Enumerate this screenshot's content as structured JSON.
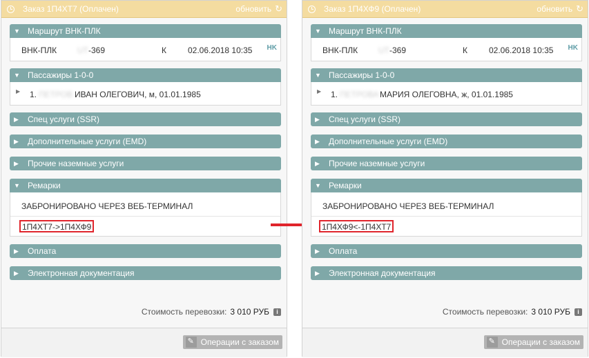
{
  "orders": [
    {
      "header": {
        "title": "Заказ 1П4ХТ7 (Оплачен)",
        "refresh_label": "обновить",
        "refresh_icon": "refresh-icon",
        "clock_icon": "clock-icon"
      },
      "route": {
        "title": "Маршрут ВНК-ПЛК",
        "segment": "ВНК-ПЛК",
        "flight_prefix": "UT",
        "flight_number": "-369",
        "class": "К",
        "datetime": "02.06.2018 10:35",
        "status": "HK"
      },
      "passengers": {
        "title": "Пассажиры 1-0-0",
        "index": "1.",
        "surname": "ПЕТРОВ",
        "name": "ИВАН ОЛЕГОВИЧ, м, 01.01.1985"
      },
      "sections": {
        "ssr": "Спец услуги (SSR)",
        "emd": "Дополнительные услуги (EMD)",
        "ground": "Прочие наземные услуги",
        "remarks": "Ремарки",
        "payment": "Оплата",
        "edocs": "Электронная документация"
      },
      "remarks": {
        "line1": "ЗАБРОНИРОВАНО ЧЕРЕЗ ВЕБ-ТЕРМИНАЛ",
        "line2": "1П4ХТ7->1П4ХФ9"
      },
      "cost": {
        "label": "Стоимость перевозки:",
        "value": "3 010 РУБ"
      },
      "footer": {
        "operations_label": "Операции с заказом"
      }
    },
    {
      "header": {
        "title": "Заказ 1П4ХФ9 (Оплачен)",
        "refresh_label": "обновить",
        "refresh_icon": "refresh-icon",
        "clock_icon": "clock-icon"
      },
      "route": {
        "title": "Маршрут ВНК-ПЛК",
        "segment": "ВНК-ПЛК",
        "flight_prefix": "UT",
        "flight_number": "-369",
        "class": "К",
        "datetime": "02.06.2018 10:35",
        "status": "HK"
      },
      "passengers": {
        "title": "Пассажиры 1-0-0",
        "index": "1.",
        "surname": "ПЕТРОВА",
        "name": "МАРИЯ ОЛЕГОВНА, ж, 01.01.1985"
      },
      "sections": {
        "ssr": "Спец услуги (SSR)",
        "emd": "Дополнительные услуги (EMD)",
        "ground": "Прочие наземные услуги",
        "remarks": "Ремарки",
        "payment": "Оплата",
        "edocs": "Электронная документация"
      },
      "remarks": {
        "line1": "ЗАБРОНИРОВАНО ЧЕРЕЗ ВЕБ-ТЕРМИНАЛ",
        "line2": "1П4ХФ9<-1П4ХТ7"
      },
      "cost": {
        "label": "Стоимость перевозки:",
        "value": "3 010 РУБ"
      },
      "footer": {
        "operations_label": "Операции с заказом"
      }
    }
  ],
  "colors": {
    "header": "#f4dca0",
    "section": "#7fa8a8",
    "highlight": "#e0242b",
    "status": "#5f9da7"
  }
}
